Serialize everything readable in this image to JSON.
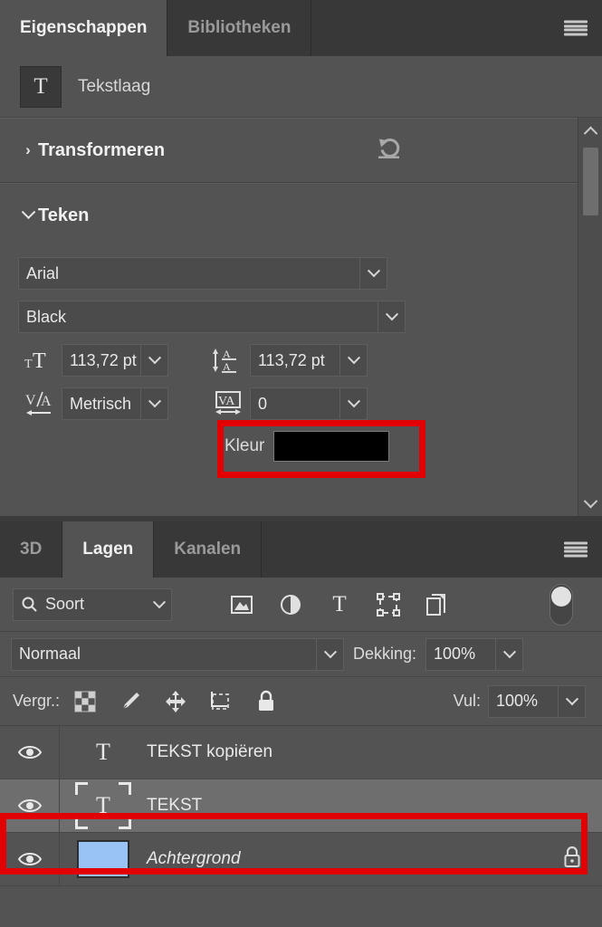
{
  "properties_panel": {
    "tabs": [
      {
        "label": "Eigenschappen",
        "active": true
      },
      {
        "label": "Bibliotheken",
        "active": false
      }
    ],
    "menu_icon": "hamburger-menu-icon",
    "header": {
      "icon": "text-layer-icon",
      "icon_glyph": "T",
      "label": "Tekstlaag"
    },
    "sections": {
      "transform": {
        "title": "Transformeren",
        "collapsed": true,
        "twisty_glyph": "›",
        "reset_icon": "reset-transform-icon"
      },
      "character": {
        "title": "Teken",
        "collapsed": false,
        "twisty_glyph": "⌄",
        "font_family": "Arial",
        "font_style": "Black",
        "font_size_icon": "font-size-icon",
        "font_size": "113,72 pt",
        "leading_icon": "leading-icon",
        "leading": "113,72 pt",
        "kerning_icon": "kerning-icon",
        "kerning": "Metrisch",
        "tracking_icon": "tracking-icon",
        "tracking": "0",
        "color_label": "Kleur",
        "color_value": "#000000"
      }
    },
    "scrollbar": {
      "up_arrow": "scroll-up-icon",
      "down_arrow": "scroll-down-icon"
    }
  },
  "layers_panel": {
    "tabs": [
      {
        "label": "3D",
        "active": false
      },
      {
        "label": "Lagen",
        "active": true
      },
      {
        "label": "Kanalen",
        "active": false
      }
    ],
    "menu_icon": "hamburger-menu-icon",
    "filter": {
      "search_icon": "search-icon",
      "kind_label": "Soort",
      "icons": [
        "filter-image-icon",
        "filter-adjustment-icon",
        "filter-type-icon",
        "filter-shape-icon",
        "filter-smartobject-icon"
      ],
      "toggle": "filter-enable-toggle"
    },
    "blend": {
      "mode": "Normaal",
      "opacity_label": "Dekking:",
      "opacity_value": "100%"
    },
    "lock": {
      "label": "Vergr.:",
      "icons": [
        "lock-transparency-icon",
        "lock-image-icon",
        "lock-position-icon",
        "lock-artboard-icon",
        "lock-all-icon"
      ],
      "fill_label": "Vul:",
      "fill_value": "100%"
    },
    "layers": [
      {
        "name": "TEKST kopiëren",
        "visible": true,
        "visibility_icon": "eye-icon",
        "thumb": "text-layer-thumbnail",
        "thumb_glyph": "T",
        "selected": false,
        "italic": false,
        "locked": false,
        "highlighted": false
      },
      {
        "name": "TEKST",
        "visible": true,
        "visibility_icon": "eye-icon",
        "thumb": "text-layer-thumbnail-selected",
        "thumb_glyph": "T",
        "selected": true,
        "italic": false,
        "locked": false,
        "highlighted": true
      },
      {
        "name": "Achtergrond",
        "visible": true,
        "visibility_icon": "eye-icon",
        "thumb": "background-layer-thumbnail",
        "thumb_color": "#99C3F5",
        "selected": false,
        "italic": true,
        "locked": true,
        "lock_icon": "lock-icon",
        "highlighted": false
      }
    ]
  },
  "annotations": {
    "highlight_color": "#E30000",
    "boxes": [
      {
        "name": "kleur-highlight"
      },
      {
        "name": "tekst-layer-highlight"
      }
    ]
  }
}
